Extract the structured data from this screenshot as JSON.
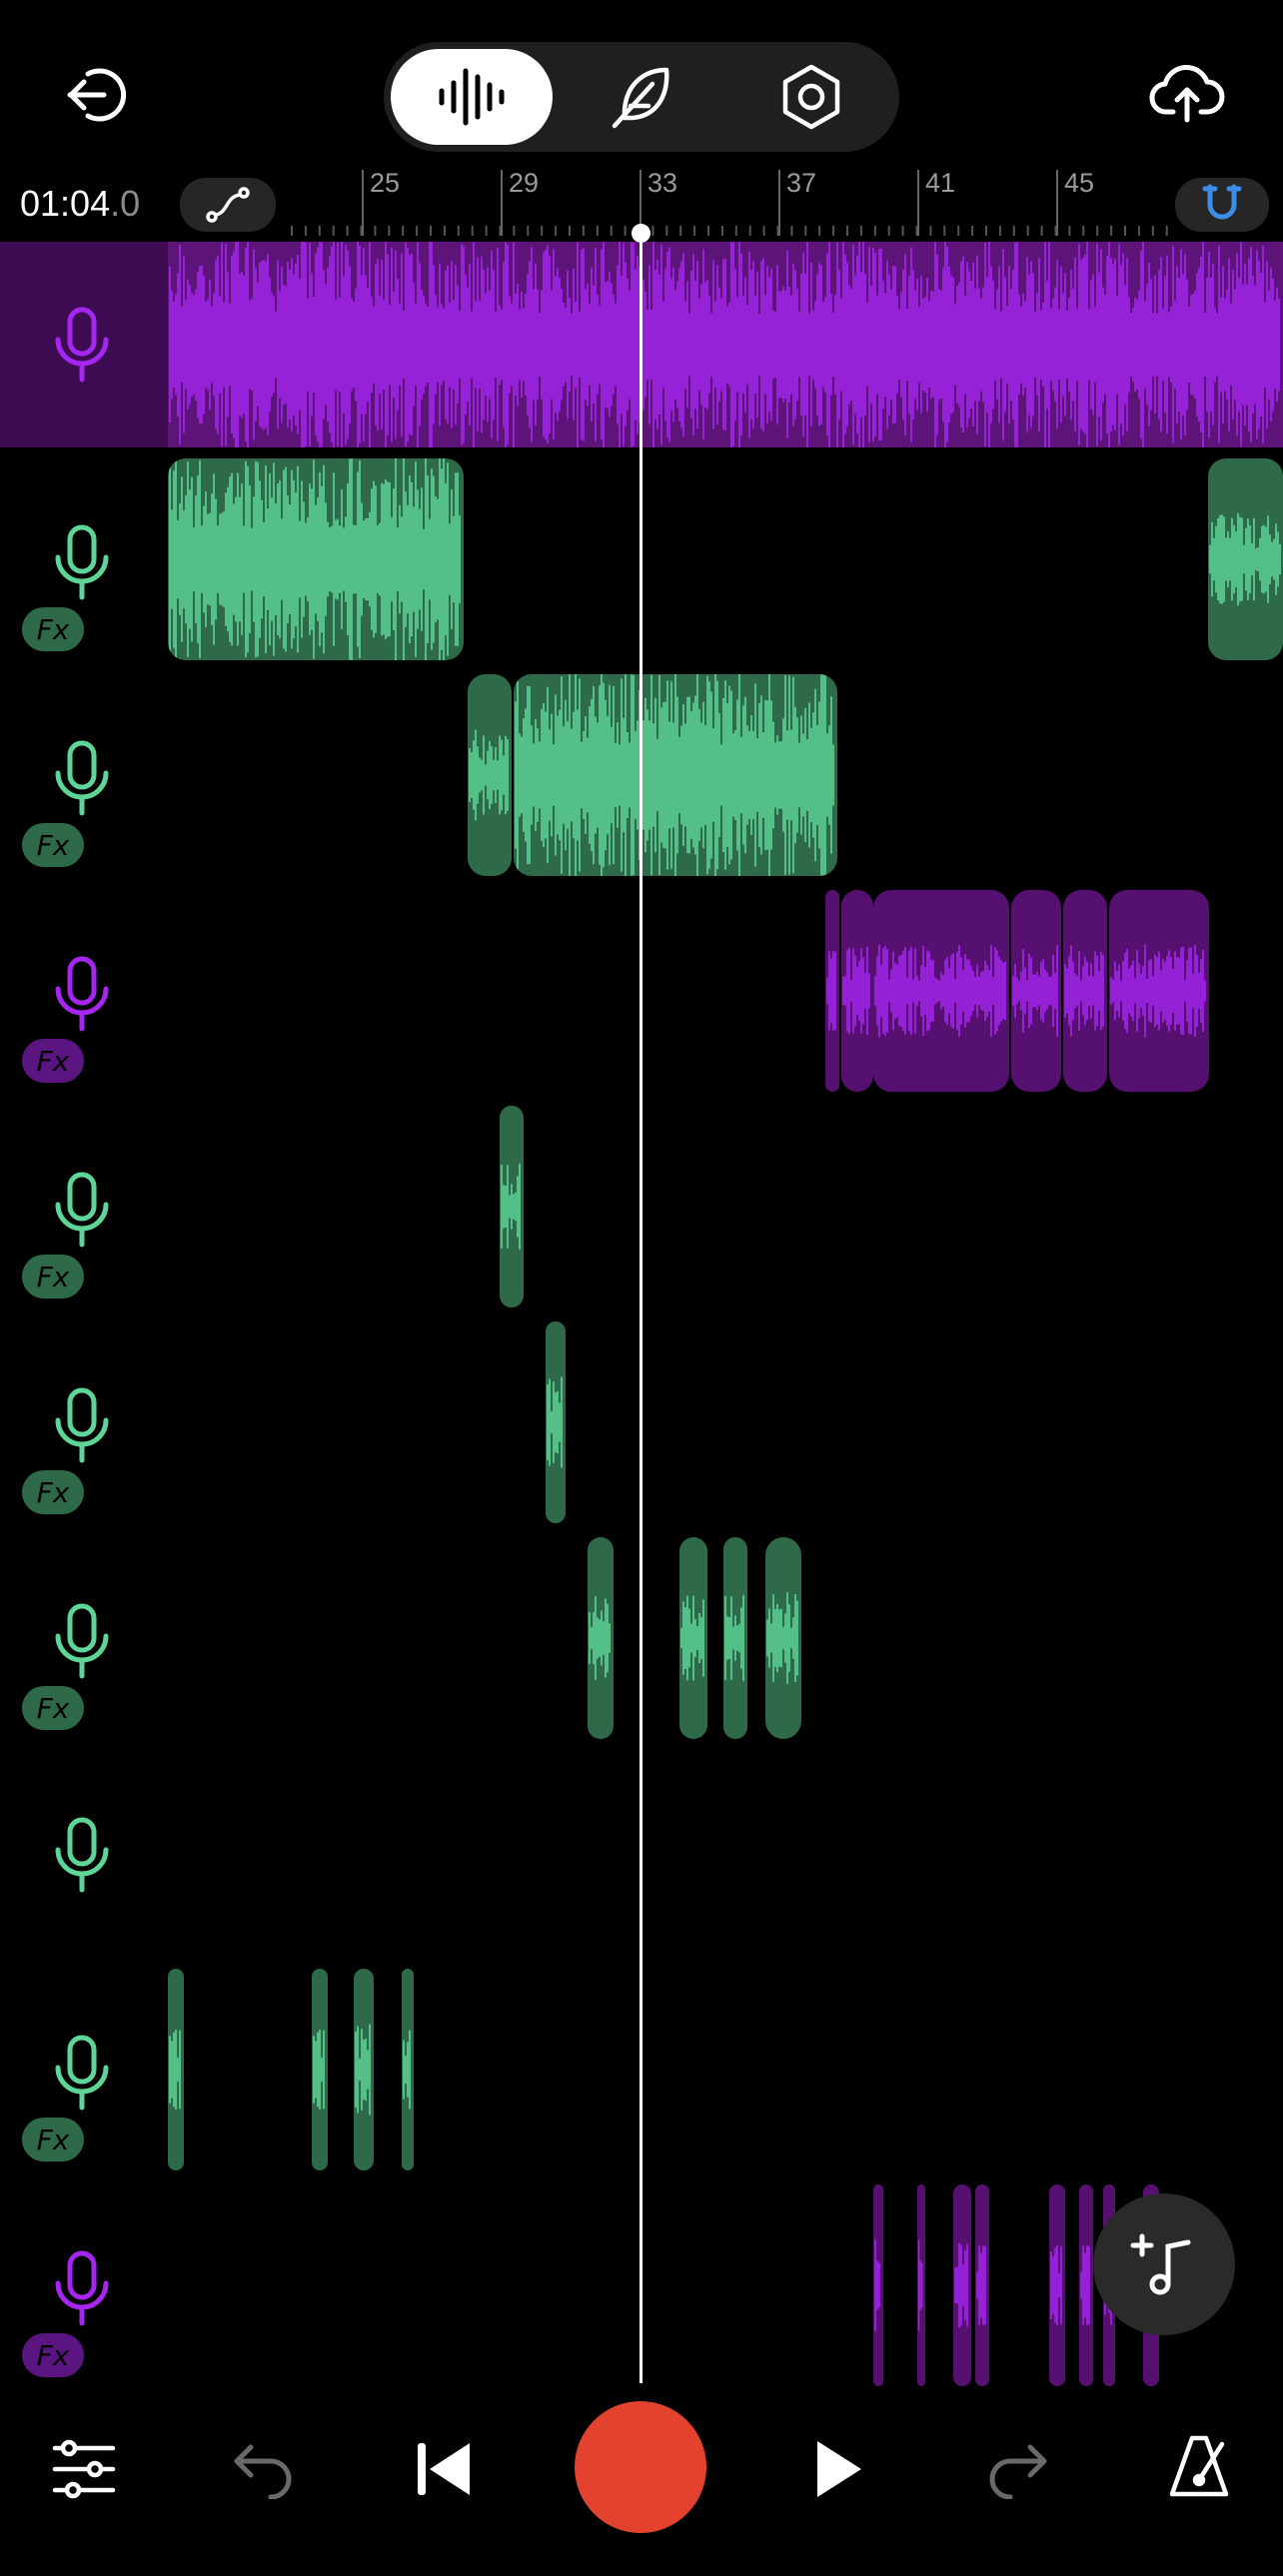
{
  "header": {
    "exit_icon": "exit-icon",
    "modes": [
      {
        "name": "waveform",
        "icon": "waveform-icon",
        "active": true
      },
      {
        "name": "feather",
        "icon": "feather-icon",
        "active": false
      },
      {
        "name": "settings",
        "icon": "hex-nut-icon",
        "active": false
      }
    ],
    "cloud_icon": "cloud-upload-icon"
  },
  "ruler": {
    "time_main": "01:04",
    "time_frac": ".0",
    "bar_labels": [
      "25",
      "29",
      "33",
      "37",
      "41",
      "45"
    ],
    "automation_icon": "automation-curve-icon",
    "snap_icon": "magnet-icon"
  },
  "colors": {
    "purple": "#a526f0",
    "purple_dark": "#56106f",
    "purple_row": "#3c0b52",
    "green": "#5ed598",
    "green_dark": "#2e6a4a",
    "record": "#e3432e"
  },
  "tracks": [
    {
      "color": "purple",
      "fx": false,
      "selected": true
    },
    {
      "color": "green",
      "fx": true
    },
    {
      "color": "green",
      "fx": true
    },
    {
      "color": "purple",
      "fx": true
    },
    {
      "color": "green",
      "fx": true
    },
    {
      "color": "green",
      "fx": true
    },
    {
      "color": "green",
      "fx": true
    },
    {
      "color": "green",
      "fx": false
    },
    {
      "color": "green",
      "fx": true
    },
    {
      "color": "purple",
      "fx": true
    }
  ],
  "fx_label": "Fx",
  "transport": {
    "mixer_icon": "sliders-icon",
    "undo_icon": "undo-icon",
    "skip_back_icon": "skip-back-icon",
    "record_icon": "record-button",
    "play_icon": "play-icon",
    "redo_icon": "redo-icon",
    "metronome_icon": "metronome-icon"
  },
  "fab_icon": "add-music-icon"
}
